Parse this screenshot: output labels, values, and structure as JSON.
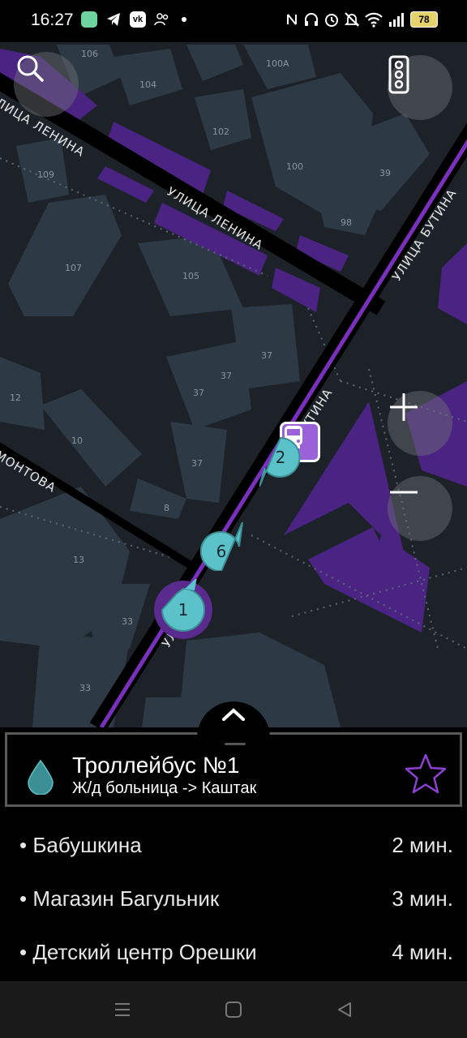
{
  "status_bar": {
    "time": "16:27",
    "battery": "78",
    "icons_left": [
      "app-icon",
      "telegram-icon",
      "vk-icon",
      "users-icon",
      "dot-icon"
    ],
    "icons_right": [
      "nfc-icon",
      "headset-icon",
      "alarm-icon",
      "mute-icon",
      "wifi-icon",
      "signal-icon",
      "battery-icon"
    ]
  },
  "map": {
    "streets": {
      "lenina_left": "УЛИЦА ЛЕНИНА",
      "lenina_mid": "УЛИЦА ЛЕНИНА",
      "butina_top": "УЛИЦА БУТИНА",
      "butina_mid": "БУТИНА",
      "butina_bottom": "УЛ",
      "montova": "МОНТОВА"
    },
    "house_numbers": {
      "h106": "106",
      "h104": "104",
      "h100a": "100А",
      "h102": "102",
      "h100": "100",
      "h39": "39",
      "h98": "98",
      "h109": "109",
      "h107": "107",
      "h105": "105",
      "h37a": "37",
      "h37b": "37",
      "h37c": "37",
      "h37d": "37",
      "h12": "12",
      "h10": "10",
      "h8": "8",
      "h13": "13",
      "h33a": "33",
      "h33b": "33"
    },
    "markers": [
      {
        "label": "2"
      },
      {
        "label": "6"
      },
      {
        "label": "1"
      }
    ]
  },
  "colors": {
    "accent_purple": "#7b2fbf",
    "marker_teal": "#5cc2c9",
    "map_bg": "#1c2228"
  },
  "route": {
    "title": "Троллейбус №1",
    "direction": "Ж/д больница -> Каштак"
  },
  "stops": [
    {
      "name": "• Бабушкина",
      "time": "2 мин."
    },
    {
      "name": "• Магазин Багульник",
      "time": "3 мин."
    },
    {
      "name": "• Детский центр Орешки",
      "time": "4 мин."
    }
  ]
}
